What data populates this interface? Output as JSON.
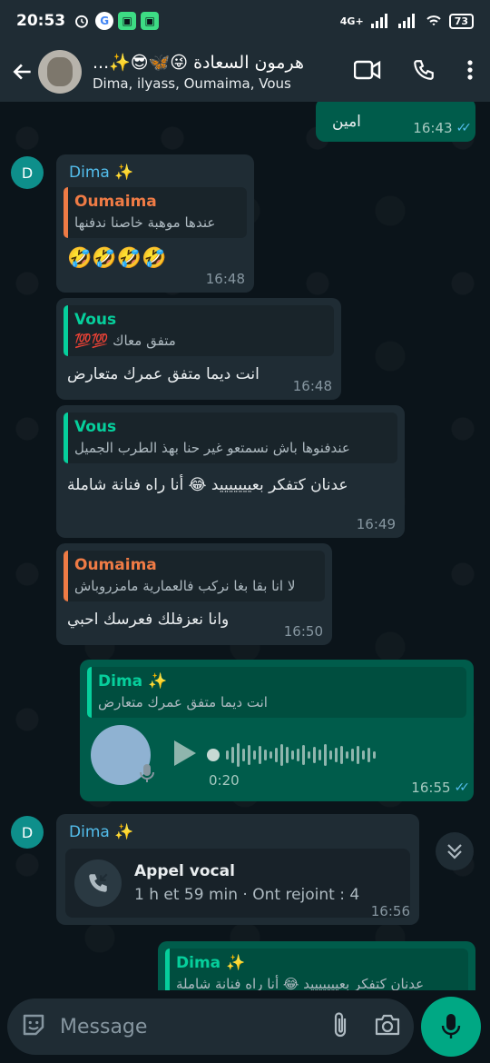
{
  "status_bar": {
    "time": "20:53",
    "network": "4G+",
    "battery": "73"
  },
  "header": {
    "title": "هرمون السعادة 😜🦋😎✨...",
    "members": "Dima, ilyass, Oumaima, Vous"
  },
  "messages": [
    {
      "id": "m0",
      "text": "امين",
      "time": "16:43"
    },
    {
      "id": "m1",
      "sender": "Dima ✨",
      "avatar_letter": "D",
      "quote_name": "Oumaima",
      "quote_text": "عندها موهبة خاصنا ندفنها",
      "text": "🤣🤣🤣🤣",
      "time": "16:48"
    },
    {
      "id": "m2",
      "quote_name": "Vous",
      "quote_text": "متفق معاك 💯💯",
      "text": "انت ديما متفق عمرك متعارض",
      "time": "16:48"
    },
    {
      "id": "m3",
      "quote_name": "Vous",
      "quote_text": "عندفنوها باش نسمتعو غير حنا بهذ الطرب الجميل",
      "text": "عدنان كتفكر بعيييييييد 😂 أنا راه فنانة شاملة",
      "time": "16:49"
    },
    {
      "id": "m4",
      "quote_name": "Oumaima",
      "quote_text": "لا انا بقا بغا نركب فالعمارية مامزروباش",
      "text": "وانا نعزفلك فعرسك احبي",
      "time": "16:50"
    },
    {
      "id": "m5",
      "quote_name": "Dima ✨",
      "quote_text": "انت ديما متفق عمرك متعارض",
      "voice_duration": "0:20",
      "time": "16:55"
    },
    {
      "id": "m6",
      "sender": "Dima ✨",
      "avatar_letter": "D",
      "call_title": "Appel vocal",
      "call_sub": "1 h et 59 min · Ont rejoint : 4",
      "time": "16:56"
    },
    {
      "id": "m7",
      "quote_name": "Dima ✨",
      "quote_text": "عدنان كتفكر بعيييييييد 😂 أنا راه فنانة شاملة"
    }
  ],
  "composer": {
    "placeholder": "Message"
  },
  "colors": {
    "accent": "#00a884",
    "incoming_bubble": "#1f2c34",
    "outgoing_bubble": "#005c4b",
    "read_ticks": "#53bdeb"
  }
}
